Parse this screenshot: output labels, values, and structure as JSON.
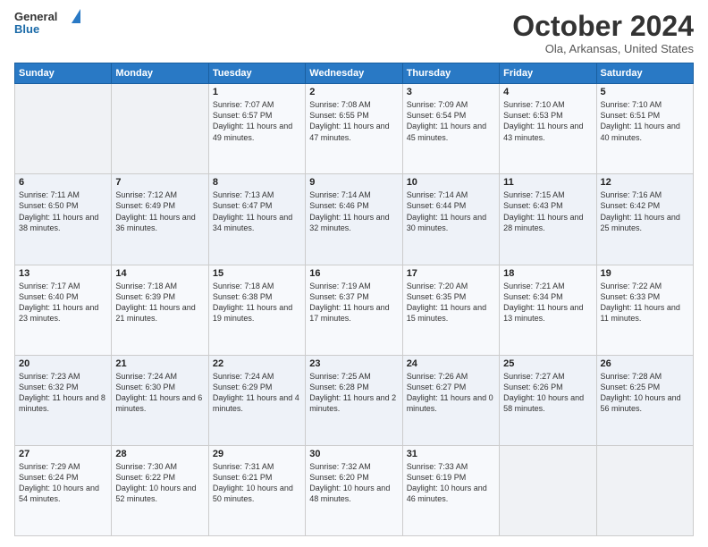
{
  "header": {
    "logo_line1": "General",
    "logo_line2": "Blue",
    "month_title": "October 2024",
    "location": "Ola, Arkansas, United States"
  },
  "days_of_week": [
    "Sunday",
    "Monday",
    "Tuesday",
    "Wednesday",
    "Thursday",
    "Friday",
    "Saturday"
  ],
  "weeks": [
    [
      {
        "day": "",
        "content": ""
      },
      {
        "day": "",
        "content": ""
      },
      {
        "day": "1",
        "content": "Sunrise: 7:07 AM\nSunset: 6:57 PM\nDaylight: 11 hours and 49 minutes."
      },
      {
        "day": "2",
        "content": "Sunrise: 7:08 AM\nSunset: 6:55 PM\nDaylight: 11 hours and 47 minutes."
      },
      {
        "day": "3",
        "content": "Sunrise: 7:09 AM\nSunset: 6:54 PM\nDaylight: 11 hours and 45 minutes."
      },
      {
        "day": "4",
        "content": "Sunrise: 7:10 AM\nSunset: 6:53 PM\nDaylight: 11 hours and 43 minutes."
      },
      {
        "day": "5",
        "content": "Sunrise: 7:10 AM\nSunset: 6:51 PM\nDaylight: 11 hours and 40 minutes."
      }
    ],
    [
      {
        "day": "6",
        "content": "Sunrise: 7:11 AM\nSunset: 6:50 PM\nDaylight: 11 hours and 38 minutes."
      },
      {
        "day": "7",
        "content": "Sunrise: 7:12 AM\nSunset: 6:49 PM\nDaylight: 11 hours and 36 minutes."
      },
      {
        "day": "8",
        "content": "Sunrise: 7:13 AM\nSunset: 6:47 PM\nDaylight: 11 hours and 34 minutes."
      },
      {
        "day": "9",
        "content": "Sunrise: 7:14 AM\nSunset: 6:46 PM\nDaylight: 11 hours and 32 minutes."
      },
      {
        "day": "10",
        "content": "Sunrise: 7:14 AM\nSunset: 6:44 PM\nDaylight: 11 hours and 30 minutes."
      },
      {
        "day": "11",
        "content": "Sunrise: 7:15 AM\nSunset: 6:43 PM\nDaylight: 11 hours and 28 minutes."
      },
      {
        "day": "12",
        "content": "Sunrise: 7:16 AM\nSunset: 6:42 PM\nDaylight: 11 hours and 25 minutes."
      }
    ],
    [
      {
        "day": "13",
        "content": "Sunrise: 7:17 AM\nSunset: 6:40 PM\nDaylight: 11 hours and 23 minutes."
      },
      {
        "day": "14",
        "content": "Sunrise: 7:18 AM\nSunset: 6:39 PM\nDaylight: 11 hours and 21 minutes."
      },
      {
        "day": "15",
        "content": "Sunrise: 7:18 AM\nSunset: 6:38 PM\nDaylight: 11 hours and 19 minutes."
      },
      {
        "day": "16",
        "content": "Sunrise: 7:19 AM\nSunset: 6:37 PM\nDaylight: 11 hours and 17 minutes."
      },
      {
        "day": "17",
        "content": "Sunrise: 7:20 AM\nSunset: 6:35 PM\nDaylight: 11 hours and 15 minutes."
      },
      {
        "day": "18",
        "content": "Sunrise: 7:21 AM\nSunset: 6:34 PM\nDaylight: 11 hours and 13 minutes."
      },
      {
        "day": "19",
        "content": "Sunrise: 7:22 AM\nSunset: 6:33 PM\nDaylight: 11 hours and 11 minutes."
      }
    ],
    [
      {
        "day": "20",
        "content": "Sunrise: 7:23 AM\nSunset: 6:32 PM\nDaylight: 11 hours and 8 minutes."
      },
      {
        "day": "21",
        "content": "Sunrise: 7:24 AM\nSunset: 6:30 PM\nDaylight: 11 hours and 6 minutes."
      },
      {
        "day": "22",
        "content": "Sunrise: 7:24 AM\nSunset: 6:29 PM\nDaylight: 11 hours and 4 minutes."
      },
      {
        "day": "23",
        "content": "Sunrise: 7:25 AM\nSunset: 6:28 PM\nDaylight: 11 hours and 2 minutes."
      },
      {
        "day": "24",
        "content": "Sunrise: 7:26 AM\nSunset: 6:27 PM\nDaylight: 11 hours and 0 minutes."
      },
      {
        "day": "25",
        "content": "Sunrise: 7:27 AM\nSunset: 6:26 PM\nDaylight: 10 hours and 58 minutes."
      },
      {
        "day": "26",
        "content": "Sunrise: 7:28 AM\nSunset: 6:25 PM\nDaylight: 10 hours and 56 minutes."
      }
    ],
    [
      {
        "day": "27",
        "content": "Sunrise: 7:29 AM\nSunset: 6:24 PM\nDaylight: 10 hours and 54 minutes."
      },
      {
        "day": "28",
        "content": "Sunrise: 7:30 AM\nSunset: 6:22 PM\nDaylight: 10 hours and 52 minutes."
      },
      {
        "day": "29",
        "content": "Sunrise: 7:31 AM\nSunset: 6:21 PM\nDaylight: 10 hours and 50 minutes."
      },
      {
        "day": "30",
        "content": "Sunrise: 7:32 AM\nSunset: 6:20 PM\nDaylight: 10 hours and 48 minutes."
      },
      {
        "day": "31",
        "content": "Sunrise: 7:33 AM\nSunset: 6:19 PM\nDaylight: 10 hours and 46 minutes."
      },
      {
        "day": "",
        "content": ""
      },
      {
        "day": "",
        "content": ""
      }
    ]
  ]
}
